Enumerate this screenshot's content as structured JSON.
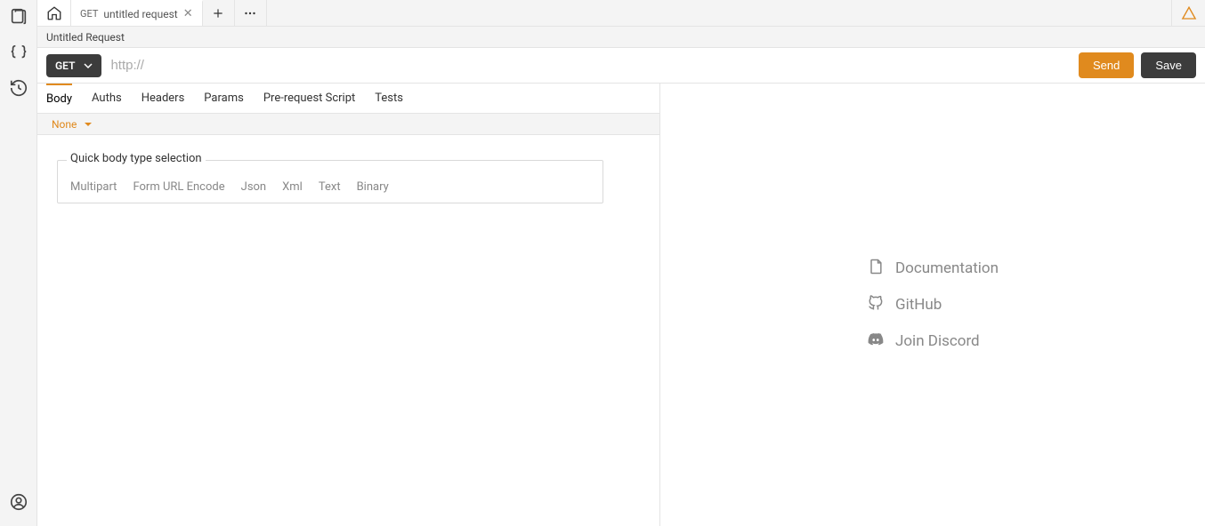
{
  "tab": {
    "method": "GET",
    "title": "untitled request"
  },
  "request": {
    "title": "Untitled Request",
    "method": "GET",
    "url_placeholder": "http://",
    "url_value": ""
  },
  "actions": {
    "send": "Send",
    "save": "Save"
  },
  "subTabs": {
    "body": "Body",
    "auths": "Auths",
    "headers": "Headers",
    "params": "Params",
    "prerequest": "Pre-request Script",
    "tests": "Tests"
  },
  "bodyType": {
    "selected": "None"
  },
  "quickBody": {
    "legend": "Quick body type selection",
    "options": {
      "multipart": "Multipart",
      "formurl": "Form URL Encode",
      "json": "Json",
      "xml": "Xml",
      "text": "Text",
      "binary": "Binary"
    }
  },
  "rightLinks": {
    "documentation": "Documentation",
    "github": "GitHub",
    "discord": "Join Discord"
  },
  "icons": {
    "collections": "collections-icon",
    "env": "env-braces-icon",
    "history": "history-icon",
    "account": "account-icon",
    "home": "home-icon",
    "plus": "plus-icon",
    "more": "more-horizontal-icon",
    "warn": "warning-triangle-icon",
    "chevron": "chevron-down-icon",
    "doc": "document-icon",
    "github_ic": "github-icon",
    "discord_ic": "discord-icon"
  },
  "colors": {
    "accent": "#e08a1e",
    "dark": "#3c3c3c"
  }
}
